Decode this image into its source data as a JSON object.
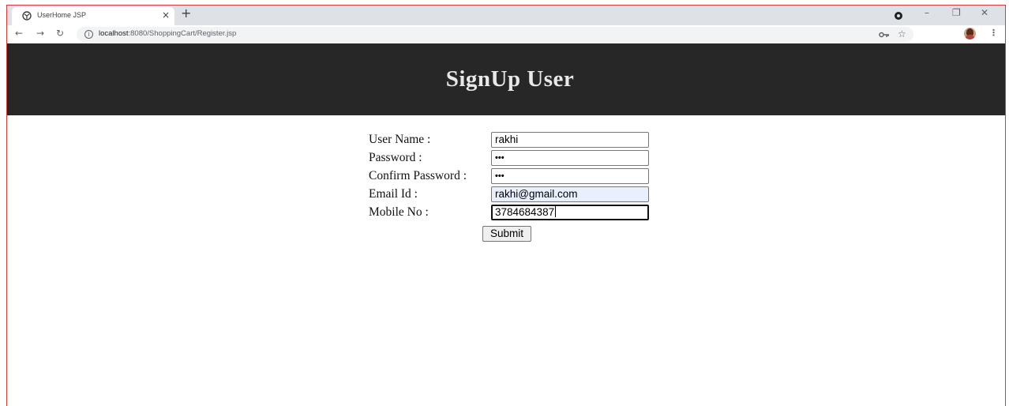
{
  "browser": {
    "tab_title": "UserHome JSP",
    "tab_close": "×",
    "new_tab": "+",
    "url_host": "localhost",
    "url_path": ":8080/ShoppingCart/Register.jsp",
    "icons": {
      "favicon": "globe-icon",
      "back": "back-arrow-icon",
      "forward": "forward-arrow-icon",
      "reload": "reload-icon",
      "info": "info-icon",
      "key": "key-icon",
      "star": "star-icon",
      "menu": "kebab-menu-icon"
    },
    "window_controls": {
      "minimize": "–",
      "restore": "❐",
      "close": "✕"
    }
  },
  "page": {
    "title": "SignUp User",
    "form": {
      "fields": [
        {
          "label": "User Name :",
          "value": "rakhi"
        },
        {
          "label": "Password :",
          "value": "•••"
        },
        {
          "label": "Confirm Password :",
          "value": "•••"
        },
        {
          "label": "Email Id :",
          "value": "rakhi@gmail.com"
        },
        {
          "label": "Mobile No :",
          "value": "3784684387"
        }
      ],
      "submit_label": "Submit"
    },
    "colors": {
      "banner": "#272727",
      "banner_text": "#e8e8e8",
      "autofill": "#e8f0fe"
    }
  }
}
